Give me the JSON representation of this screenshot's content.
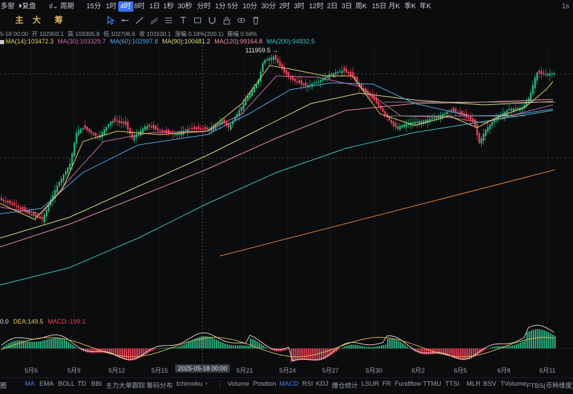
{
  "toolbar": {
    "left_stub": "多窗",
    "compare_label": "复盘",
    "period_label": "周期",
    "intervals": [
      "15分",
      "1时",
      "4时",
      "8时",
      "1日",
      "1秒",
      "30秒",
      "分时",
      "1分",
      "5分",
      "10分",
      "30分",
      "2时",
      "3时",
      "12时",
      "2日",
      "3日",
      "周K",
      "15日",
      "月K",
      "季K",
      "年K"
    ],
    "active_interval": "4时",
    "right_label": "1s"
  },
  "draw_toolbar": {
    "labels": [
      "主",
      "大",
      "筹"
    ]
  },
  "ohlc": {
    "date_stub": "5-18 00:00",
    "open": "开 102900.1",
    "high": "高 103305.8",
    "low": "低 102706.6",
    "close": "收 103100.1",
    "change": "涨幅 0.19%(200.1)",
    "amplitude": "振幅 0.58%"
  },
  "ma_legend": [
    {
      "label": "MA(14):103472.3",
      "color": "#e9d45f"
    },
    {
      "label": "MA(30):103329.7",
      "color": "#d36aa8"
    },
    {
      "label": "MA(60):102997.8",
      "color": "#58a8e8"
    },
    {
      "label": "MA(90):100481.2",
      "color": "#e3dc8a"
    },
    {
      "label": "MA(120):99164.8",
      "color": "#f08fa0"
    },
    {
      "label": "MA(200):94932.5",
      "color": "#3cc8c8"
    }
  ],
  "annotation": {
    "high_label": "111959.5"
  },
  "macd_legend": {
    "dif": "0.0",
    "dea": "DEA:149.5",
    "macd": "MACD:-199.1"
  },
  "date_axis": {
    "labels": [
      "5月6",
      "5月9",
      "5月12",
      "5月15",
      "5月18",
      "5月21",
      "5月24",
      "5月27",
      "5月30",
      "6月2",
      "6月5",
      "6月8",
      "6月11"
    ],
    "cursor_date": "2025-05-18 00:00"
  },
  "indicator_tabs": {
    "left_stub": "圈",
    "main": [
      "MA",
      "EMA",
      "BOLL",
      "TD",
      "BBI",
      "主力大单跟踪",
      "筹码分布",
      "Ichimoku"
    ],
    "sub": [
      "Volume",
      "Position",
      "MACD",
      "RSI",
      "KDJ",
      "爆仓统计",
      "LSUR",
      "FR",
      "Fundflow",
      "TTMU",
      "TTSI",
      "MLR",
      "BSV",
      "TVolume",
      "FTBS(币种维度)"
    ],
    "active_main": "MA",
    "active_sub": "MACD"
  },
  "colors": {
    "up": "#2ebd85",
    "down": "#f6465d",
    "accent": "#3a6ff7",
    "dif_line": "#e9e9e9",
    "dea_line": "#e9c84f"
  },
  "icons": [
    "cursor-icon",
    "horizontal-line-icon",
    "ray-icon",
    "channel-icon",
    "fib-icon",
    "text-icon",
    "measure-icon",
    "magnet-icon",
    "lock-icon",
    "eye-icon",
    "trash-icon"
  ]
}
